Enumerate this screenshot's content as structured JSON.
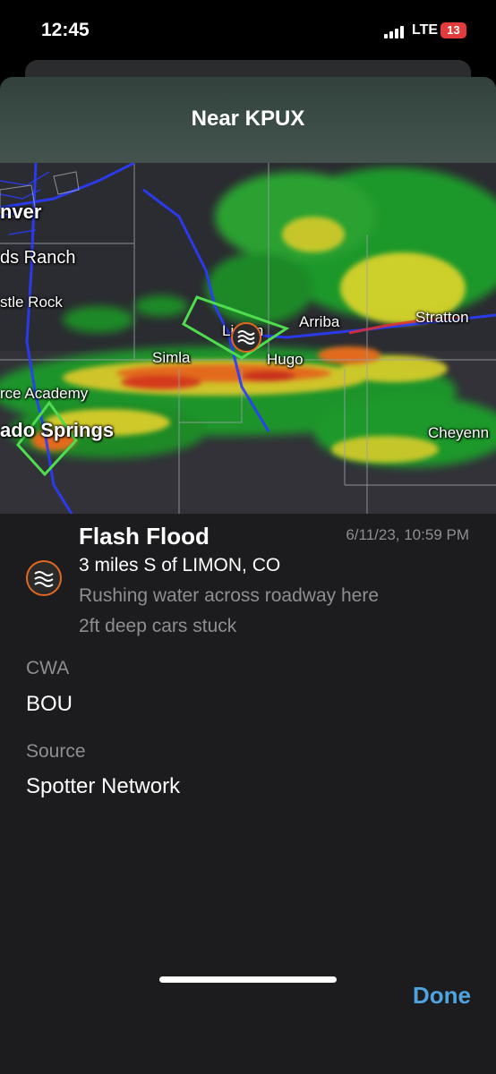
{
  "status_bar": {
    "time": "12:45",
    "network": "LTE",
    "battery": "13",
    "signal_bars": 4
  },
  "sheet": {
    "title": "Near KPUX"
  },
  "map": {
    "labels": {
      "denver": "nver",
      "highlands_ranch": "ds Ranch",
      "castle_rock": "stle Rock",
      "limon": "Limon",
      "arriba": "Arriba",
      "stratton": "Stratton",
      "simla": "Simla",
      "hugo": "Hugo",
      "air_force_academy": "rce Academy",
      "colorado_springs": "ado Springs",
      "cheyenne": "Cheyenn"
    },
    "marker_icon": "flood-waves-icon",
    "colors": {
      "warning_polygon": "#4fdc4f",
      "marker_ring": "#e2671f",
      "roads": "#2433ff"
    }
  },
  "report": {
    "icon": "flood-waves-icon",
    "title": "Flash Flood",
    "datetime": "6/11/23, 10:59 PM",
    "location": "3 miles S of LIMON, CO",
    "description_line1": "Rushing water across roadway here",
    "description_line2": "2ft deep cars stuck"
  },
  "fields": {
    "cwa_label": "CWA",
    "cwa_value": "BOU",
    "source_label": "Source",
    "source_value": "Spotter Network"
  },
  "actions": {
    "done_label": "Done"
  }
}
